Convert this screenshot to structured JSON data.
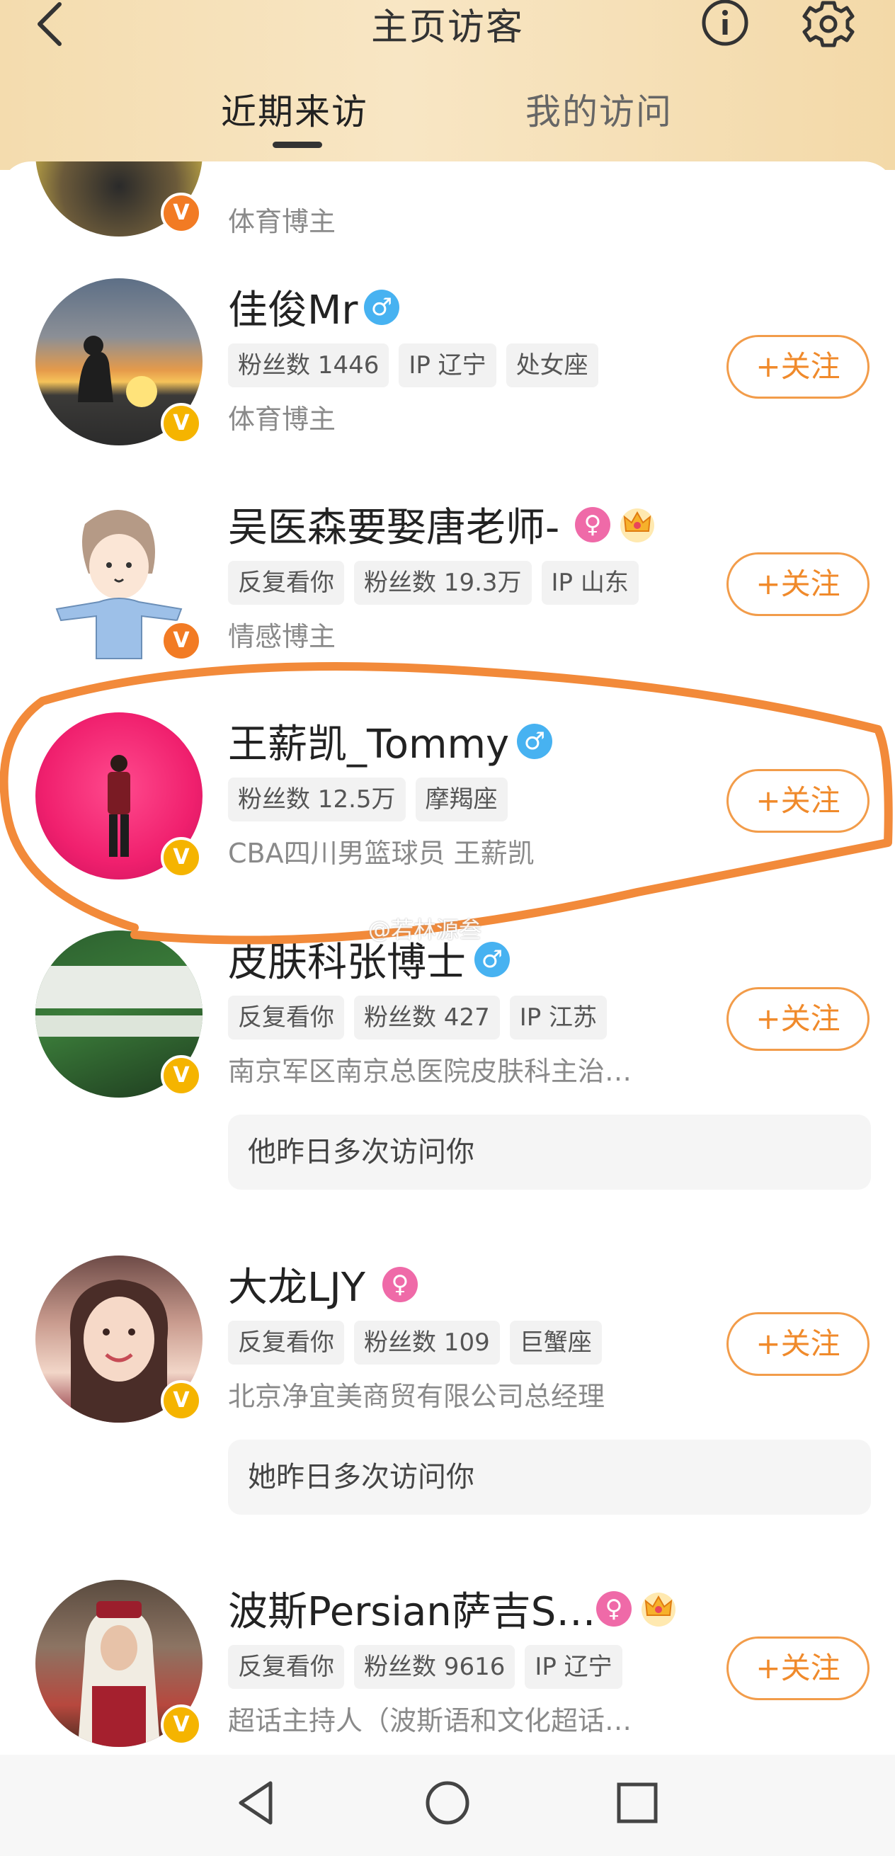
{
  "header": {
    "title": "主页访客",
    "tabs": [
      {
        "label": "近期来访",
        "active": true
      },
      {
        "label": "我的访问",
        "active": false
      }
    ],
    "icons": [
      "chevron-left-icon",
      "info-icon",
      "gear-icon"
    ]
  },
  "follow_label": "+关注",
  "visitors": [
    {
      "name": "",
      "desc": "体育博主",
      "badge": "V",
      "badge_color": "#f27b24"
    },
    {
      "name": "佳俊Mr",
      "gender": "♂",
      "tags": [
        "粉丝数 1446",
        "IP 辽宁",
        "处女座"
      ],
      "desc": "体育博主",
      "badge": "V",
      "badge_color": "#f5b400"
    },
    {
      "name": "吴医森要娶唐老师-",
      "gender": "♀",
      "crown": true,
      "tags": [
        "反复看你",
        "粉丝数 19.3万",
        "IP 山东"
      ],
      "desc": "情感博主",
      "badge": "V",
      "badge_color": "#f27b24"
    },
    {
      "name": "王薪凯_Tommy",
      "gender": "♂",
      "tags": [
        "粉丝数 12.5万",
        "摩羯座"
      ],
      "desc": "CBA四川男篮球员 王薪凯",
      "badge": "V",
      "badge_color": "#f5b400",
      "highlighted": true
    },
    {
      "name": "皮肤科张博士",
      "gender": "♂",
      "tags": [
        "反复看你",
        "粉丝数 427",
        "IP 江苏"
      ],
      "desc": "南京军区南京总医院皮肤科主治…",
      "note": "他昨日多次访问你",
      "badge": "V",
      "badge_color": "#f5b400"
    },
    {
      "name": "大龙LJY",
      "gender": "♀",
      "tags": [
        "反复看你",
        "粉丝数 109",
        "巨蟹座"
      ],
      "desc": "北京净宜美商贸有限公司总经理",
      "note": "她昨日多次访问你",
      "badge": "V",
      "badge_color": "#f5b400"
    },
    {
      "name": "波斯Persian萨吉S…",
      "gender": "♀",
      "crown": true,
      "tags": [
        "反复看你",
        "粉丝数 9616",
        "IP 辽宁"
      ],
      "desc": "超话主持人（波斯语和文化超话…",
      "badge": "V",
      "badge_color": "#f5b400"
    }
  ],
  "watermark": "@若林源叁",
  "navbar": [
    "back-triangle-icon",
    "home-circle-icon",
    "recents-square-icon"
  ]
}
